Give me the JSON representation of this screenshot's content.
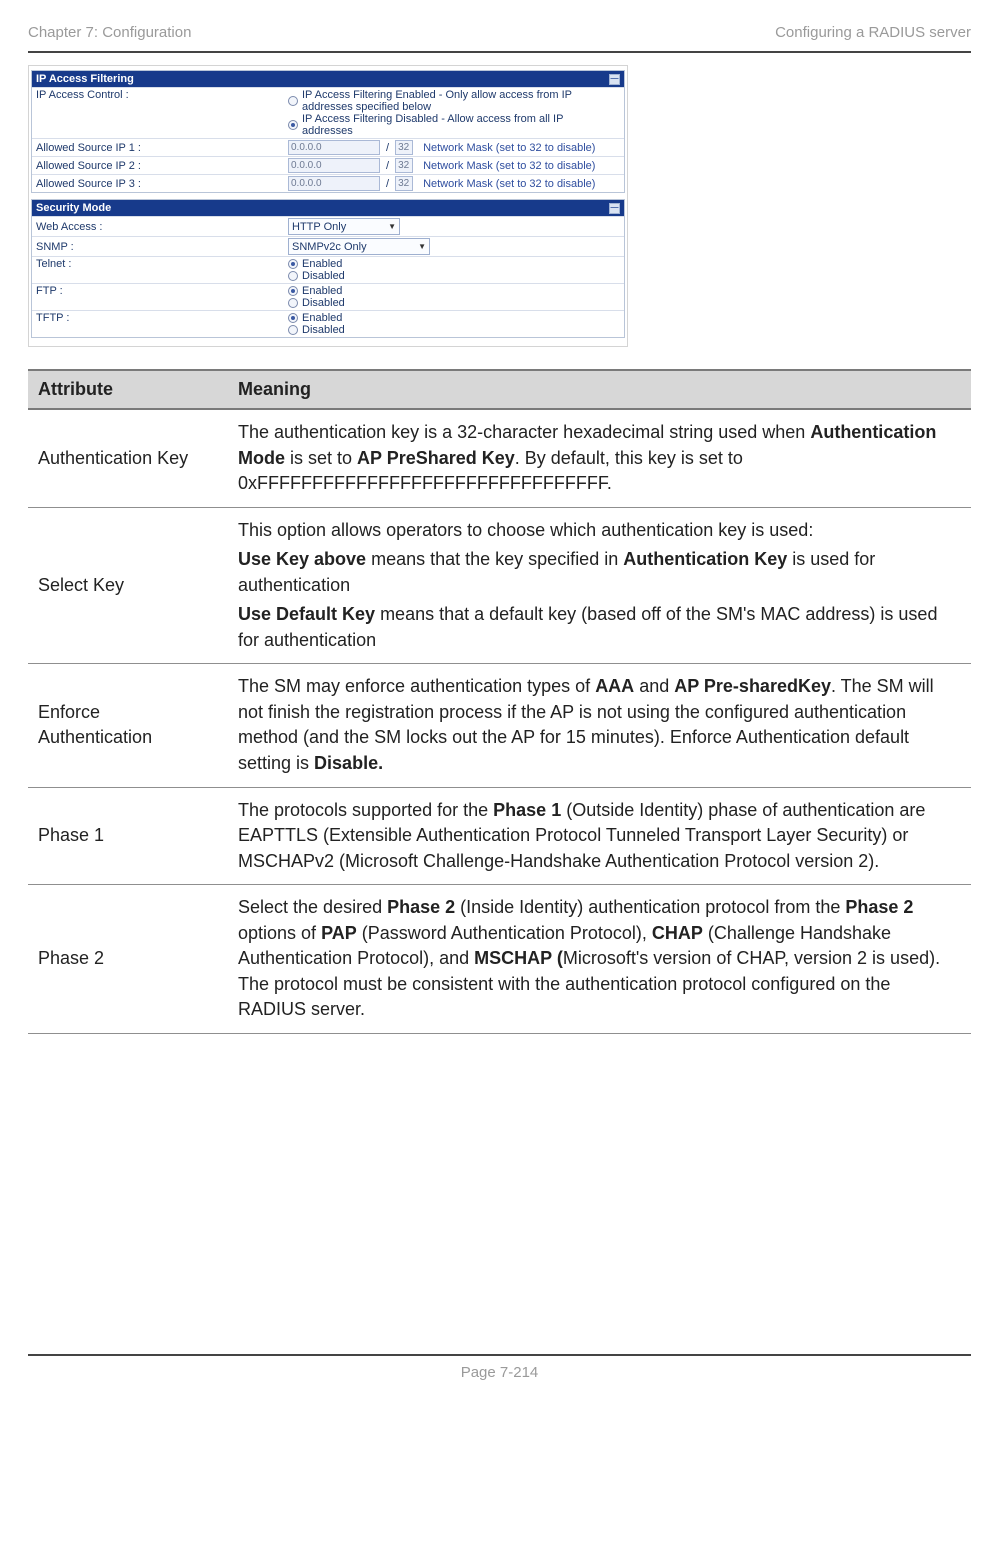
{
  "header": {
    "left": "Chapter 7:  Configuration",
    "right": "Configuring a RADIUS server"
  },
  "footer": {
    "text": "Page 7-214"
  },
  "screenshot": {
    "panel_filter": {
      "title": "IP Access Filtering",
      "access_control_label": "IP Access Control :",
      "option_enabled": "IP Access Filtering Enabled - Only allow access from IP addresses specified below",
      "option_disabled": "IP Access Filtering Disabled - Allow access from all IP addresses",
      "rows": [
        {
          "label": "Allowed Source IP 1 :",
          "ip": "0.0.0.0",
          "mask": "32",
          "hint": "Network Mask (set to 32 to disable)"
        },
        {
          "label": "Allowed Source IP 2 :",
          "ip": "0.0.0.0",
          "mask": "32",
          "hint": "Network Mask (set to 32 to disable)"
        },
        {
          "label": "Allowed Source IP 3 :",
          "ip": "0.0.0.0",
          "mask": "32",
          "hint": "Network Mask (set to 32 to disable)"
        }
      ]
    },
    "panel_security": {
      "title": "Security Mode",
      "web_label": "Web Access :",
      "web_value": "HTTP Only",
      "snmp_label": "SNMP :",
      "snmp_value": "SNMPv2c Only",
      "enabled": "Enabled",
      "disabled": "Disabled",
      "telnet_label": "Telnet :",
      "ftp_label": "FTP :",
      "tftp_label": "TFTP :"
    }
  },
  "table": {
    "head_attr": "Attribute",
    "head_mean": "Meaning",
    "rows": {
      "r0": {
        "attr": "Authentication Key",
        "p1a": "The authentication key is a 32-character hexadecimal string used when ",
        "p1b": "Authentication Mode",
        "p1c": " is set to ",
        "p1d": "AP PreShared Key",
        "p1e": ". By default, this key is set to 0xFFFFFFFFFFFFFFFFFFFFFFFFFFFFFFFF."
      },
      "r1": {
        "attr": "Select Key",
        "p1": "This option allows operators to choose which authentication key is used:",
        "p2a": "Use Key above",
        "p2b": " means that the key specified in ",
        "p2c": "Authentication Key",
        "p2d": " is used for authentication",
        "p3a": "Use Default Key",
        "p3b": " means that a default key (based off of the SM's MAC address) is used for authentication"
      },
      "r2": {
        "attr": "Enforce Authentication",
        "p1a": "The SM may enforce authentication types of ",
        "p1b": "AAA",
        "p1c": " and ",
        "p1d": "AP Pre-sharedKey",
        "p1e": ". The SM will not finish the registration process if the AP is not using the configured authentication method (and the SM locks out the AP for 15 minutes). Enforce Authentication default setting is ",
        "p1f": "Disable."
      },
      "r3": {
        "attr": "Phase 1",
        "p1a": "The protocols supported for the ",
        "p1b": "Phase 1",
        "p1c": " (Outside Identity) phase of authentication are EAPTTLS (Extensible Authentication Protocol Tunneled Transport Layer Security) or MSCHAPv2 (Microsoft Challenge-Handshake Authentication Protocol version 2)."
      },
      "r4": {
        "attr": "Phase 2",
        "p1a": "Select the desired ",
        "p1b": "Phase 2",
        "p1c": " (Inside Identity) authentication protocol from the ",
        "p1d": "Phase 2",
        "p1e": " options of ",
        "p1f": "PAP",
        "p1g": " (Password Authentication Protocol), ",
        "p1h": "CHAP",
        "p1i": " (Challenge Handshake Authentication Protocol), and ",
        "p1j": "MSCHAP (",
        "p1k": "Microsoft's version of CHAP, version 2 is used). The protocol must be consistent with the authentication protocol configured on the RADIUS server."
      }
    }
  }
}
